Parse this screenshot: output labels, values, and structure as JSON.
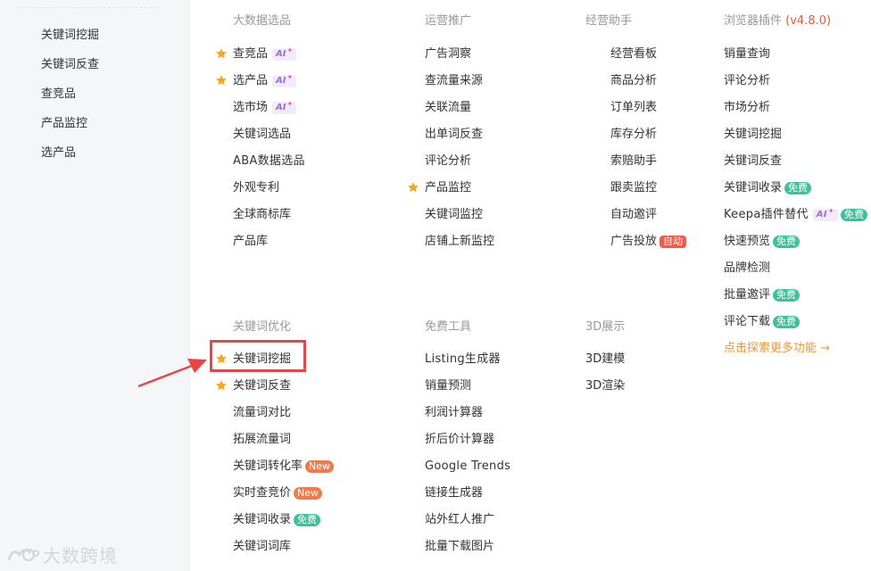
{
  "sidebar": {
    "items": [
      "关键词挖掘",
      "关键词反查",
      "查竞品",
      "产品监控",
      "选产品"
    ]
  },
  "watermark": "大数跨境",
  "columns": {
    "big_data": {
      "title": "大数据选品",
      "items": [
        "查竞品",
        "选产品",
        "选市场",
        "关键词选品",
        "ABA数据选品",
        "外观专利",
        "全球商标库",
        "产品库"
      ]
    },
    "operations": {
      "title": "运营推广",
      "items": [
        "广告洞察",
        "查流量来源",
        "关联流量",
        "出单词反查",
        "评论分析",
        "产品监控",
        "关键词监控",
        "店铺上新监控"
      ]
    },
    "assistant": {
      "title": "经营助手",
      "items": [
        "经营看板",
        "商品分析",
        "订单列表",
        "库存分析",
        "索赔助手",
        "跟卖监控",
        "自动邀评",
        "广告投放"
      ]
    },
    "plugin": {
      "title": "浏览器插件",
      "version": "(v4.8.0)",
      "items": [
        "销量查询",
        "评论分析",
        "市场分析",
        "关键词挖掘",
        "关键词反查",
        "关键词收录",
        "Keepa插件替代",
        "快速预览",
        "品牌检测",
        "批量邀评",
        "评论下载"
      ],
      "explore": "点击探索更多功能 →"
    },
    "keyword_opt": {
      "title": "关键词优化",
      "items": [
        "关键词挖掘",
        "关键词反查",
        "流量词对比",
        "拓展流量词",
        "关键词转化率",
        "实时查竞价",
        "关键词收录",
        "关键词词库"
      ]
    },
    "free_tools": {
      "title": "免费工具",
      "items": [
        "Listing生成器",
        "销量预测",
        "利润计算器",
        "折后价计算器",
        "Google Trends",
        "链接生成器",
        "站外红人推广",
        "批量下载图片"
      ]
    },
    "display3d": {
      "title": "3D展示",
      "items": [
        "3D建模",
        "3D渲染"
      ]
    }
  },
  "badges": {
    "ai": "AI",
    "ai_spark": "✦",
    "free": "免费",
    "new": "New",
    "auto": "自动"
  },
  "colors": {
    "star": "#f5a623",
    "highlight": "#e84545",
    "free_badge": "#3cc19a",
    "new_badge": "#f07a4a",
    "version": "#e05a3a",
    "explore": "#f0963a"
  }
}
